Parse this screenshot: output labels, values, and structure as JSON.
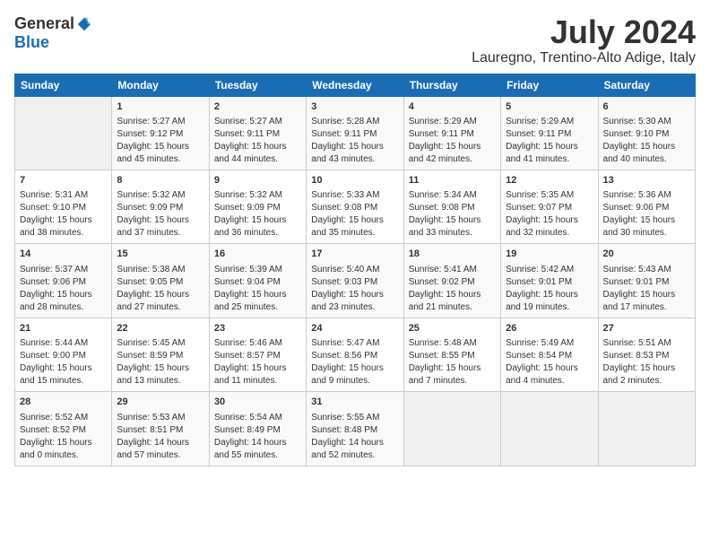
{
  "logo": {
    "general": "General",
    "blue": "Blue"
  },
  "title": "July 2024",
  "location": "Lauregno, Trentino-Alto Adige, Italy",
  "days_of_week": [
    "Sunday",
    "Monday",
    "Tuesday",
    "Wednesday",
    "Thursday",
    "Friday",
    "Saturday"
  ],
  "weeks": [
    [
      {
        "day": "",
        "info": ""
      },
      {
        "day": "1",
        "info": "Sunrise: 5:27 AM\nSunset: 9:12 PM\nDaylight: 15 hours\nand 45 minutes."
      },
      {
        "day": "2",
        "info": "Sunrise: 5:27 AM\nSunset: 9:11 PM\nDaylight: 15 hours\nand 44 minutes."
      },
      {
        "day": "3",
        "info": "Sunrise: 5:28 AM\nSunset: 9:11 PM\nDaylight: 15 hours\nand 43 minutes."
      },
      {
        "day": "4",
        "info": "Sunrise: 5:29 AM\nSunset: 9:11 PM\nDaylight: 15 hours\nand 42 minutes."
      },
      {
        "day": "5",
        "info": "Sunrise: 5:29 AM\nSunset: 9:11 PM\nDaylight: 15 hours\nand 41 minutes."
      },
      {
        "day": "6",
        "info": "Sunrise: 5:30 AM\nSunset: 9:10 PM\nDaylight: 15 hours\nand 40 minutes."
      }
    ],
    [
      {
        "day": "7",
        "info": "Sunrise: 5:31 AM\nSunset: 9:10 PM\nDaylight: 15 hours\nand 38 minutes."
      },
      {
        "day": "8",
        "info": "Sunrise: 5:32 AM\nSunset: 9:09 PM\nDaylight: 15 hours\nand 37 minutes."
      },
      {
        "day": "9",
        "info": "Sunrise: 5:32 AM\nSunset: 9:09 PM\nDaylight: 15 hours\nand 36 minutes."
      },
      {
        "day": "10",
        "info": "Sunrise: 5:33 AM\nSunset: 9:08 PM\nDaylight: 15 hours\nand 35 minutes."
      },
      {
        "day": "11",
        "info": "Sunrise: 5:34 AM\nSunset: 9:08 PM\nDaylight: 15 hours\nand 33 minutes."
      },
      {
        "day": "12",
        "info": "Sunrise: 5:35 AM\nSunset: 9:07 PM\nDaylight: 15 hours\nand 32 minutes."
      },
      {
        "day": "13",
        "info": "Sunrise: 5:36 AM\nSunset: 9:06 PM\nDaylight: 15 hours\nand 30 minutes."
      }
    ],
    [
      {
        "day": "14",
        "info": "Sunrise: 5:37 AM\nSunset: 9:06 PM\nDaylight: 15 hours\nand 28 minutes."
      },
      {
        "day": "15",
        "info": "Sunrise: 5:38 AM\nSunset: 9:05 PM\nDaylight: 15 hours\nand 27 minutes."
      },
      {
        "day": "16",
        "info": "Sunrise: 5:39 AM\nSunset: 9:04 PM\nDaylight: 15 hours\nand 25 minutes."
      },
      {
        "day": "17",
        "info": "Sunrise: 5:40 AM\nSunset: 9:03 PM\nDaylight: 15 hours\nand 23 minutes."
      },
      {
        "day": "18",
        "info": "Sunrise: 5:41 AM\nSunset: 9:02 PM\nDaylight: 15 hours\nand 21 minutes."
      },
      {
        "day": "19",
        "info": "Sunrise: 5:42 AM\nSunset: 9:01 PM\nDaylight: 15 hours\nand 19 minutes."
      },
      {
        "day": "20",
        "info": "Sunrise: 5:43 AM\nSunset: 9:01 PM\nDaylight: 15 hours\nand 17 minutes."
      }
    ],
    [
      {
        "day": "21",
        "info": "Sunrise: 5:44 AM\nSunset: 9:00 PM\nDaylight: 15 hours\nand 15 minutes."
      },
      {
        "day": "22",
        "info": "Sunrise: 5:45 AM\nSunset: 8:59 PM\nDaylight: 15 hours\nand 13 minutes."
      },
      {
        "day": "23",
        "info": "Sunrise: 5:46 AM\nSunset: 8:57 PM\nDaylight: 15 hours\nand 11 minutes."
      },
      {
        "day": "24",
        "info": "Sunrise: 5:47 AM\nSunset: 8:56 PM\nDaylight: 15 hours\nand 9 minutes."
      },
      {
        "day": "25",
        "info": "Sunrise: 5:48 AM\nSunset: 8:55 PM\nDaylight: 15 hours\nand 7 minutes."
      },
      {
        "day": "26",
        "info": "Sunrise: 5:49 AM\nSunset: 8:54 PM\nDaylight: 15 hours\nand 4 minutes."
      },
      {
        "day": "27",
        "info": "Sunrise: 5:51 AM\nSunset: 8:53 PM\nDaylight: 15 hours\nand 2 minutes."
      }
    ],
    [
      {
        "day": "28",
        "info": "Sunrise: 5:52 AM\nSunset: 8:52 PM\nDaylight: 15 hours\nand 0 minutes."
      },
      {
        "day": "29",
        "info": "Sunrise: 5:53 AM\nSunset: 8:51 PM\nDaylight: 14 hours\nand 57 minutes."
      },
      {
        "day": "30",
        "info": "Sunrise: 5:54 AM\nSunset: 8:49 PM\nDaylight: 14 hours\nand 55 minutes."
      },
      {
        "day": "31",
        "info": "Sunrise: 5:55 AM\nSunset: 8:48 PM\nDaylight: 14 hours\nand 52 minutes."
      },
      {
        "day": "",
        "info": ""
      },
      {
        "day": "",
        "info": ""
      },
      {
        "day": "",
        "info": ""
      }
    ]
  ]
}
